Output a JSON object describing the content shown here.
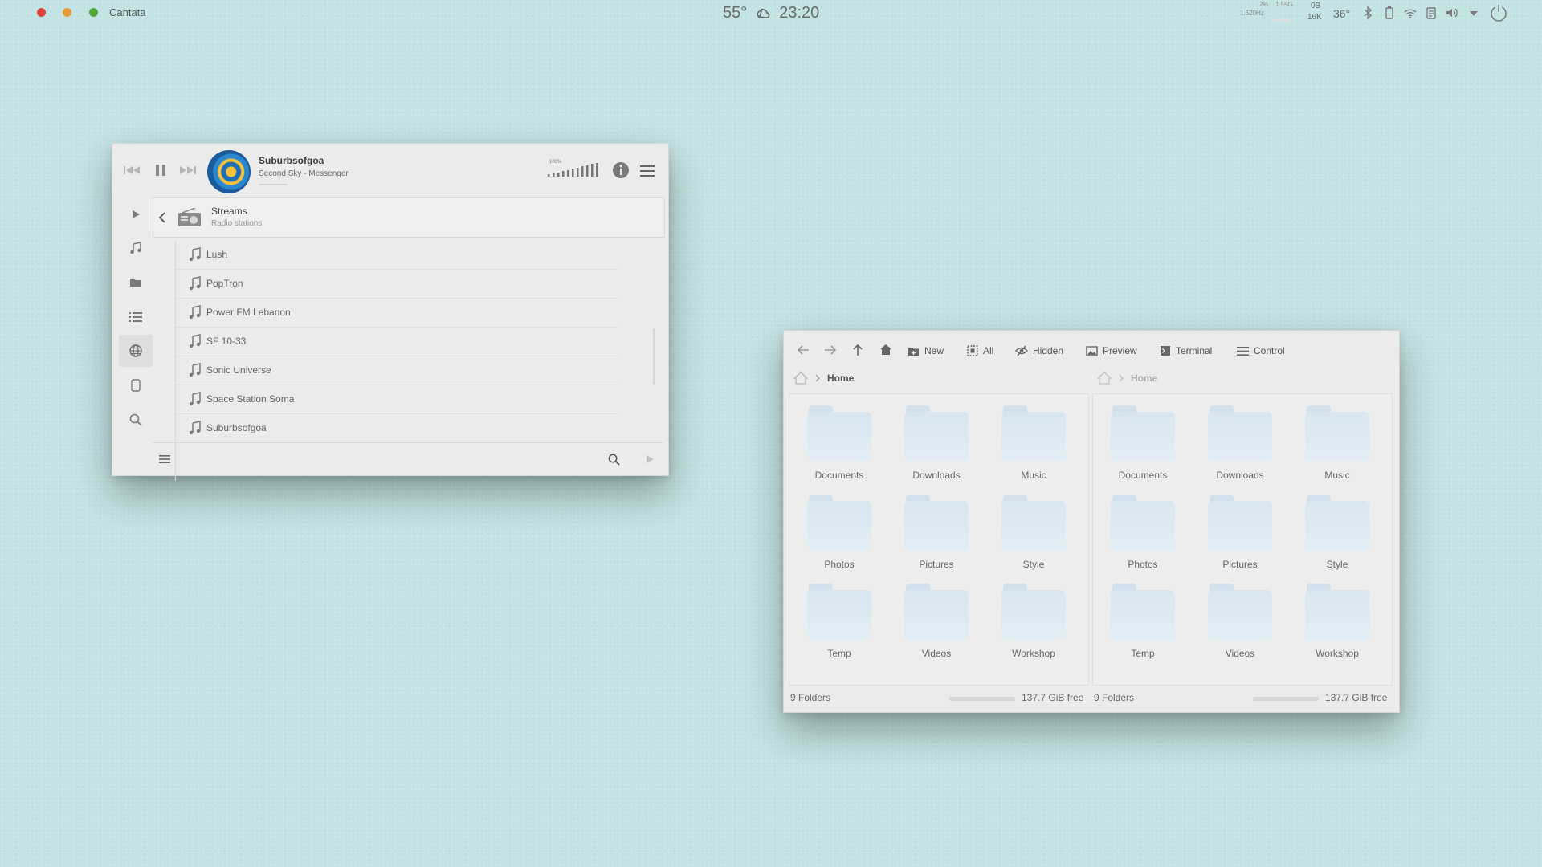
{
  "topbar": {
    "app_name": "Cantata",
    "traffic_lights": [
      "#e0443e",
      "#e99a32",
      "#4ea83a"
    ],
    "temperature": "55°",
    "time": "23:20",
    "cpu_pct": "2%",
    "cpu_freq": "1.620Hz",
    "mem": "1.55G",
    "net_up": "0B",
    "net_down": "16K",
    "cpu_temp": "36°"
  },
  "cantata": {
    "track_title": "Suburbsofgoa",
    "track_sub": "Second Sky - Messenger",
    "volume_label": "100%",
    "volume_level": 1.0,
    "header_title": "Streams",
    "header_sub": "Radio stations",
    "stations": [
      "Lush",
      "PopTron",
      "Power FM Lebanon",
      "SF 10-33",
      "Sonic Universe",
      "Space Station Soma",
      "Suburbsofgoa"
    ],
    "sidebar_icons": [
      "play-icon",
      "music-note-icon",
      "folder-icon",
      "list-icon",
      "globe-icon",
      "device-icon",
      "search-icon"
    ],
    "active_sidebar": "globe-icon"
  },
  "files": {
    "toolbar": {
      "new": "New",
      "all": "All",
      "hidden": "Hidden",
      "preview": "Preview",
      "terminal": "Terminal",
      "control": "Control"
    },
    "left": {
      "crumb": "Home",
      "folders": [
        "Documents",
        "Downloads",
        "Music",
        "Photos",
        "Pictures",
        "Style",
        "Temp",
        "Videos",
        "Workshop"
      ],
      "count": "9 Folders",
      "free": "137.7 GiB free"
    },
    "right": {
      "crumb": "Home",
      "folders": [
        "Documents",
        "Downloads",
        "Music",
        "Photos",
        "Pictures",
        "Style",
        "Temp",
        "Videos",
        "Workshop"
      ],
      "count": "9 Folders",
      "free": "137.7 GiB free"
    }
  }
}
